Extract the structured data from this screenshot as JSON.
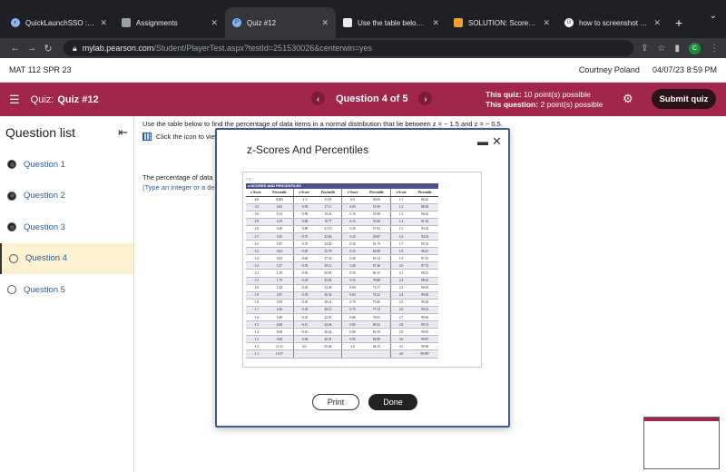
{
  "browser": {
    "tabs": [
      {
        "label": "QuickLaunchSSO :: Single S",
        "icon": "globe-icon"
      },
      {
        "label": "Assignments",
        "icon": "document-icon"
      },
      {
        "label": "Quiz #12",
        "icon": "pearson-icon"
      },
      {
        "label": "Use the table below to find t",
        "icon": "bookmark-icon"
      },
      {
        "label": "SOLUTION: Scores on the G",
        "icon": "solution-icon"
      },
      {
        "label": "how to screenshot on mac",
        "icon": "google-icon"
      }
    ],
    "tab_close_glyph": "✕",
    "new_tab_glyph": "+",
    "tab_menu_glyph": "⌄",
    "url_host": "mylab.pearson.com",
    "url_path": "/Student/PlayerTest.aspx?testId=251530026&centerwin=yes",
    "profile_initial": "C"
  },
  "header": {
    "course": "MAT 112 SPR 23",
    "user": "Courtney Poland",
    "datetime": "04/07/23 8:59 PM"
  },
  "quizbar": {
    "quiz_label": "Quiz:",
    "quiz_name": "Quiz #12",
    "question_progress": "Question 4 of 5",
    "this_quiz_label": "This quiz:",
    "this_quiz_value": "10 point(s) possible",
    "this_question_label": "This question:",
    "this_question_value": "2 point(s) possible",
    "submit_label": "Submit quiz"
  },
  "sidebar": {
    "title": "Question list",
    "items": [
      {
        "label": "Question 1"
      },
      {
        "label": "Question 2"
      },
      {
        "label": "Question 3"
      },
      {
        "label": "Question 4"
      },
      {
        "label": "Question 5"
      }
    ]
  },
  "question": {
    "prompt": "Use the table below to find the percentage of data items in a normal distribution that lie between z = − 1.5 and z = − 0.5.",
    "table_link": "Click the icon to view",
    "answer_label": "The percentage of data ite",
    "answer_hint": "(Type an integer or a deci"
  },
  "modal": {
    "title": "z-Scores And Percentiles",
    "figure_header": "z-SCORES AND PERCENTILES",
    "col_z": "z-Score",
    "col_p": "Percentile",
    "rows": [
      [
        "−4.0",
        "0.003",
        "−1.0",
        "15.87",
        "0.0",
        "50.00",
        "1.1",
        "86.43"
      ],
      [
        "−3.5",
        "0.02",
        "−0.95",
        "17.11",
        "0.05",
        "51.99",
        "1.2",
        "88.49"
      ],
      [
        "−3.0",
        "0.13",
        "−0.90",
        "18.41",
        "0.10",
        "53.98",
        "1.3",
        "90.32"
      ],
      [
        "−2.9",
        "0.19",
        "−0.85",
        "19.77",
        "0.15",
        "55.96",
        "1.4",
        "91.92"
      ],
      [
        "−2.8",
        "0.26",
        "−0.80",
        "21.19",
        "0.20",
        "57.93",
        "1.5",
        "93.32"
      ],
      [
        "−2.7",
        "0.35",
        "−0.75",
        "22.66",
        "0.25",
        "59.87",
        "1.6",
        "94.52"
      ],
      [
        "−2.6",
        "0.47",
        "−0.70",
        "24.20",
        "0.30",
        "61.79",
        "1.7",
        "95.54"
      ],
      [
        "−2.5",
        "0.62",
        "−0.65",
        "25.78",
        "0.35",
        "63.68",
        "1.8",
        "96.41"
      ],
      [
        "−2.4",
        "0.82",
        "−0.60",
        "27.43",
        "0.40",
        "65.54",
        "1.9",
        "97.13"
      ],
      [
        "−2.3",
        "1.07",
        "−0.55",
        "29.12",
        "0.45",
        "67.36",
        "2.0",
        "97.72"
      ],
      [
        "−2.2",
        "1.39",
        "−0.50",
        "30.85",
        "0.50",
        "69.15",
        "2.1",
        "98.21"
      ],
      [
        "−2.1",
        "1.79",
        "−0.45",
        "32.64",
        "0.55",
        "70.88",
        "2.2",
        "98.61"
      ],
      [
        "−2.0",
        "2.28",
        "−0.40",
        "34.46",
        "0.60",
        "72.57",
        "2.3",
        "98.93"
      ],
      [
        "−1.9",
        "2.87",
        "−0.35",
        "36.32",
        "0.65",
        "74.22",
        "2.4",
        "99.18"
      ],
      [
        "−1.8",
        "3.59",
        "−0.30",
        "38.21",
        "0.70",
        "75.80",
        "2.5",
        "99.38"
      ],
      [
        "−1.7",
        "4.46",
        "−0.25",
        "40.13",
        "0.75",
        "77.34",
        "2.6",
        "99.53"
      ],
      [
        "−1.6",
        "5.48",
        "−0.20",
        "42.07",
        "0.80",
        "78.81",
        "2.7",
        "99.65"
      ],
      [
        "−1.5",
        "6.68",
        "−0.15",
        "44.04",
        "0.85",
        "80.23",
        "2.8",
        "99.74"
      ],
      [
        "−1.4",
        "8.08",
        "−0.10",
        "46.02",
        "0.90",
        "81.59",
        "2.9",
        "99.81"
      ],
      [
        "−1.3",
        "9.68",
        "−0.05",
        "48.01",
        "0.95",
        "82.89",
        "3.0",
        "99.87"
      ],
      [
        "−1.2",
        "11.51",
        "0.0",
        "50.00",
        "1.0",
        "84.13",
        "3.5",
        "99.98"
      ],
      [
        "−1.1",
        "13.57",
        "",
        "",
        "",
        "",
        "4.0",
        "99.997"
      ]
    ],
    "print_label": "Print",
    "done_label": "Done"
  }
}
